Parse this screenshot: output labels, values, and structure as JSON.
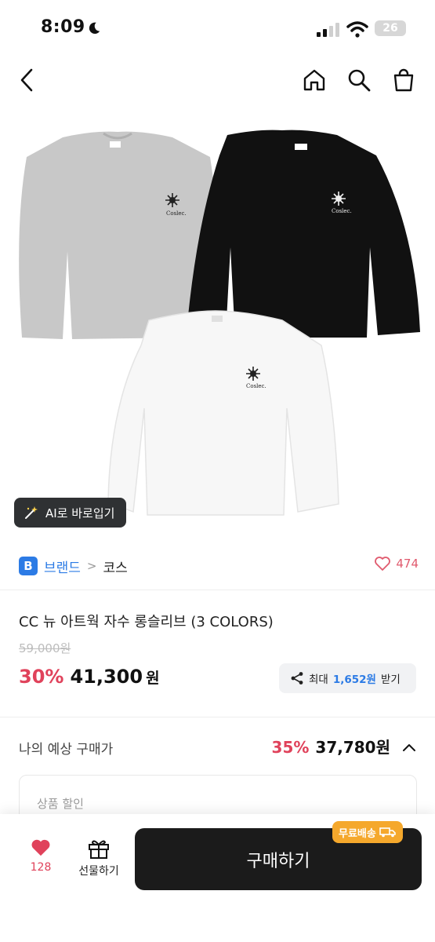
{
  "status": {
    "time": "8:09",
    "battery": "26"
  },
  "nav": {
    "back_icon": "chevron-left-icon",
    "home_icon": "home-icon",
    "search_icon": "search-icon",
    "cart_icon": "shopping-bag-icon"
  },
  "product_image": {
    "colors": [
      "#c7c7c7",
      "#111111",
      "#f7f7f7"
    ]
  },
  "ai_button": {
    "label": "AI로 바로입기"
  },
  "brand": {
    "badge": "B",
    "name": "브랜드",
    "separator": ">",
    "category": "코스",
    "like_count": "474"
  },
  "product": {
    "title": "CC 뉴 아트웍 자수 롱슬리브 (3 COLORS)",
    "original_price": "59,000원",
    "discount": "30%",
    "price": "41,300",
    "currency": "원"
  },
  "share": {
    "prefix": "최대",
    "amount": "1,652원",
    "suffix": "받기"
  },
  "expected": {
    "label": "나의 예상 구매가",
    "discount": "35%",
    "price": "37,780원"
  },
  "discount_box": {
    "label": "상품 할인"
  },
  "bottom": {
    "like_count": "128",
    "gift_label": "선물하기",
    "buy_label": "구매하기",
    "shipping_badge": "무료배송"
  },
  "theme": {
    "accent_red": "#e0425b",
    "accent_blue": "#2c7be5",
    "shipping_orange": "#f5a82c"
  }
}
